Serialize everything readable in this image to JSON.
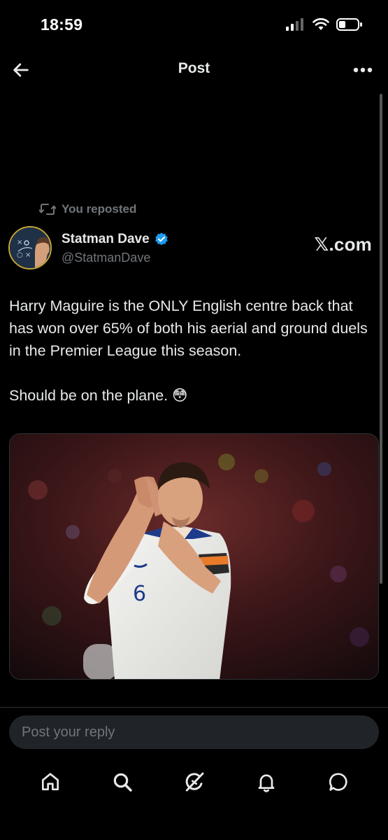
{
  "status_bar": {
    "time": "18:59"
  },
  "header": {
    "title": "Post"
  },
  "post": {
    "repost_label": "You reposted",
    "author_name": "Statman Dave",
    "author_handle": "@StatmanDave",
    "brand": "𝕏.com",
    "paragraphs": [
      "Harry Maguire is the ONLY English centre back that has won over 65% of both his aerial and ground duels in the Premier League this season.",
      "Should be on the plane. 😳"
    ],
    "image_alt": "Harry Maguire applauding in an England shirt",
    "shirt_number": "6"
  },
  "reply": {
    "placeholder": "Post your reply"
  },
  "tabs": [
    "home",
    "search",
    "grok",
    "notifications",
    "messages"
  ],
  "colors": {
    "background": "#000000",
    "text": "#e7e9ea",
    "secondary": "#71767b",
    "verified": "#1d9bf0"
  }
}
